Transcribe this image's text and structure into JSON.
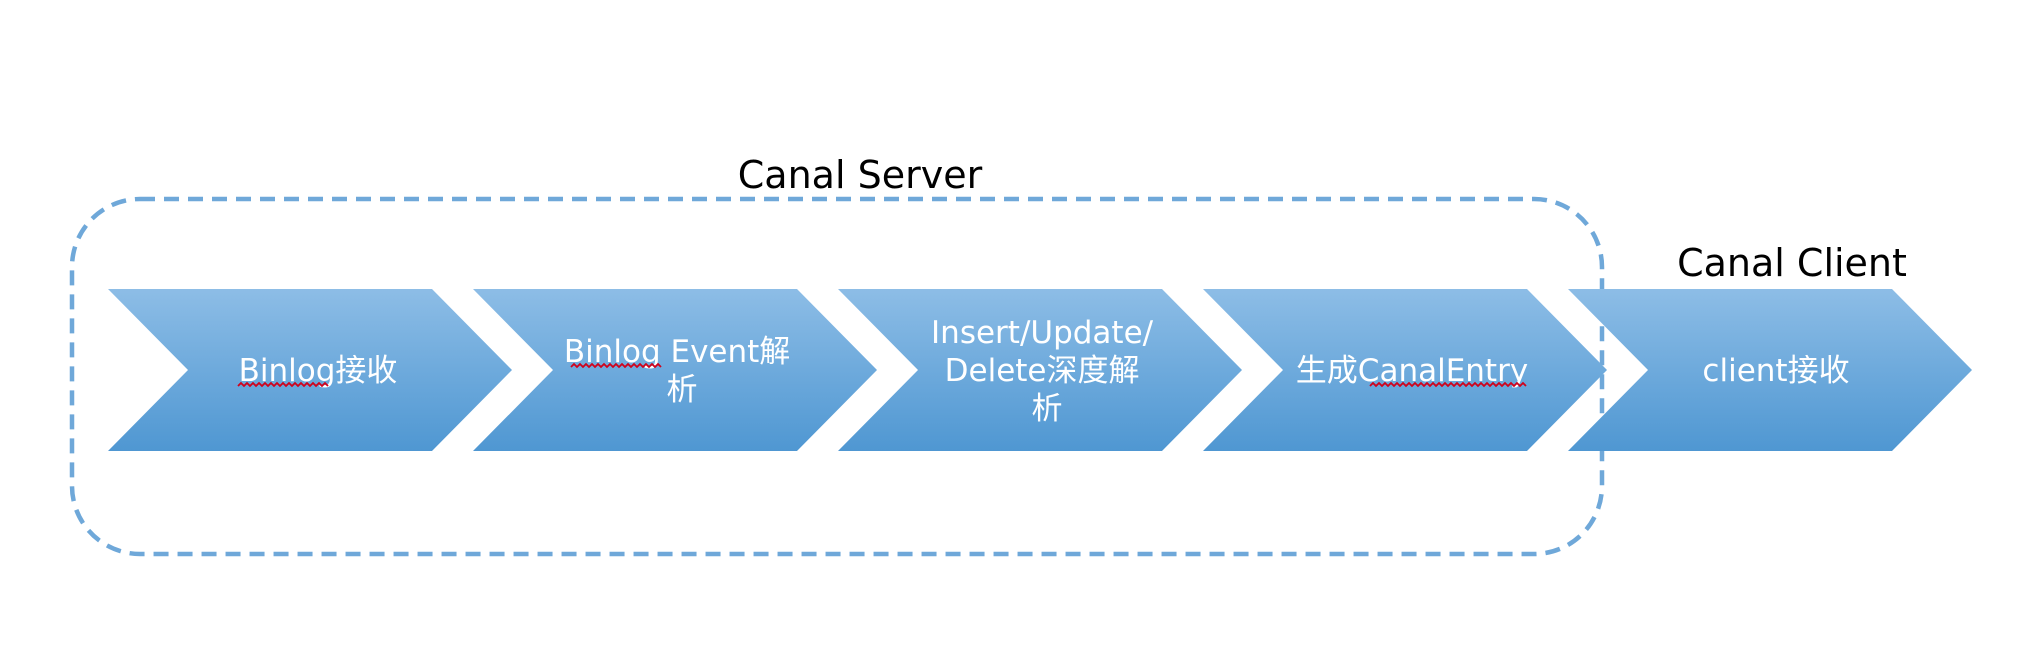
{
  "groups": {
    "server": {
      "label": "Canal Server"
    },
    "client": {
      "label": "Canal Client"
    }
  },
  "steps": [
    {
      "lines": [
        "Binlog接收"
      ]
    },
    {
      "lines": [
        "Binlog Event解",
        "析"
      ]
    },
    {
      "lines": [
        "Insert/Update/",
        "Delete深度解",
        "析"
      ]
    },
    {
      "lines": [
        "生成CanalEntry"
      ]
    },
    {
      "lines": [
        "client接收"
      ]
    }
  ],
  "colors": {
    "chevron_top": "#8dbde6",
    "chevron_bottom": "#4f97d2",
    "dashed_border": "#6fa8d9",
    "step_text": "#ffffff",
    "group_text": "#000000",
    "spellcheck_underline": "#d0021b"
  }
}
